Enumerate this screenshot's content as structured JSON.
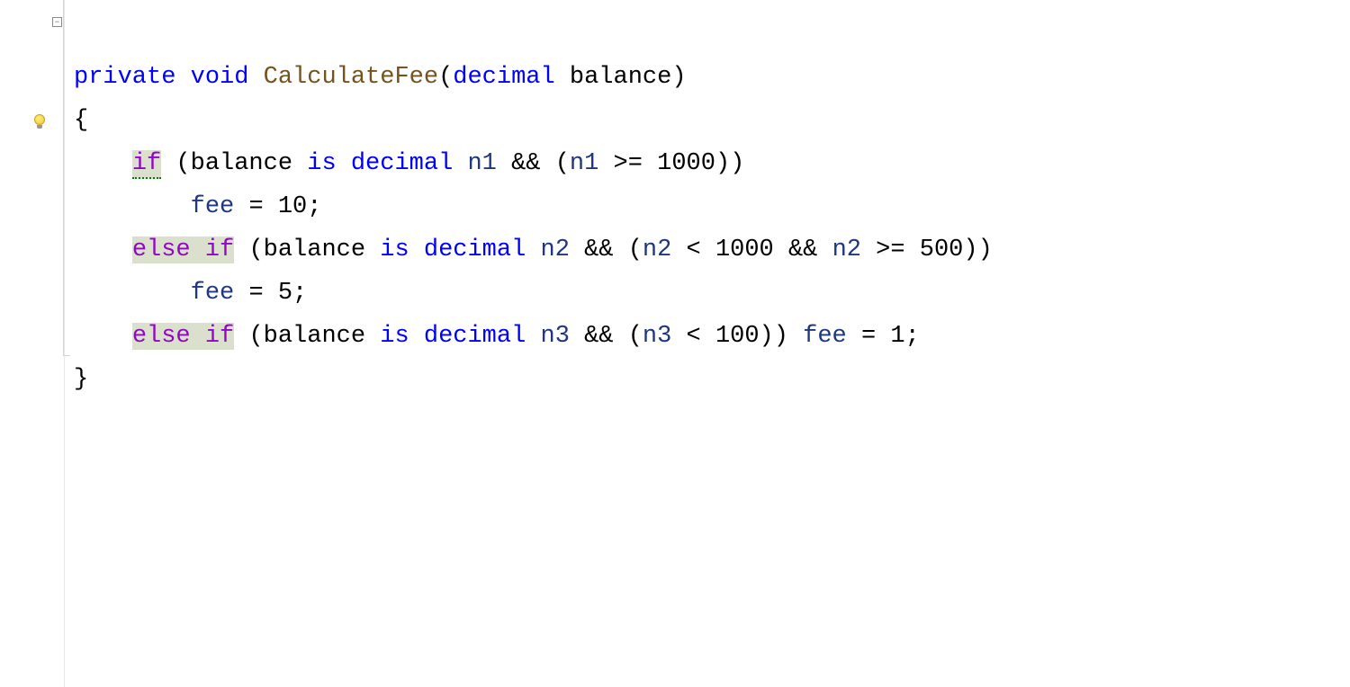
{
  "code": {
    "line1": {
      "private": "private",
      "void": "void",
      "method": "CalculateFee",
      "paren_open": "(",
      "decimal": "decimal",
      "param": "balance",
      "paren_close": ")"
    },
    "line2": {
      "brace_open": "{"
    },
    "line3": {
      "if": "if",
      "paren_open": "(",
      "balance": "balance",
      "is": "is",
      "decimal": "decimal",
      "n1": "n1",
      "and": "&&",
      "inner_paren_open": "(",
      "n1_ref": "n1",
      "gte": ">=",
      "val1000": "1000",
      "inner_paren_close": ")",
      "paren_close": ")"
    },
    "line4": {
      "fee": "fee",
      "eq": "=",
      "val10": "10",
      "semi": ";"
    },
    "line5": {
      "else": "else",
      "if": "if",
      "paren_open": "(",
      "balance": "balance",
      "is": "is",
      "decimal": "decimal",
      "n2": "n2",
      "and1": "&&",
      "inner_paren_open": "(",
      "n2_ref1": "n2",
      "lt": "<",
      "val1000": "1000",
      "and2": "&&",
      "n2_ref2": "n2",
      "gte": ">=",
      "val500": "500",
      "inner_paren_close": ")",
      "paren_close": ")"
    },
    "line6": {
      "fee": "fee",
      "eq": "=",
      "val5": "5",
      "semi": ";"
    },
    "line7": {
      "else": "else",
      "if": "if",
      "paren_open": "(",
      "balance": "balance",
      "is": "is",
      "decimal": "decimal",
      "n3": "n3",
      "and": "&&",
      "inner_paren_open": "(",
      "n3_ref": "n3",
      "lt": "<",
      "val100": "100",
      "inner_paren_close": ")",
      "paren_close": ")",
      "fee": "fee",
      "eq": "=",
      "val1": "1",
      "semi": ";"
    },
    "line8": {
      "brace_close": "}"
    }
  },
  "ui": {
    "fold_symbol": "−"
  }
}
